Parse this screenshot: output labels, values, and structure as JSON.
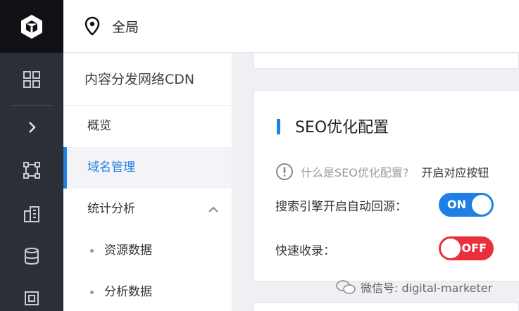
{
  "header": {
    "title": "全局"
  },
  "subnav": {
    "title": "内容分发网络CDN",
    "items": [
      {
        "label": "概览"
      },
      {
        "label": "域名管理"
      },
      {
        "label": "统计分析"
      }
    ],
    "subitems": [
      {
        "label": "资源数据"
      },
      {
        "label": "分析数据"
      }
    ]
  },
  "seo": {
    "title": "SEO优化配置",
    "help_question": "什么是SEO优化配置?",
    "help_answer": "开启对应按钮",
    "rows": [
      {
        "label": "搜索引擎开启自动回源：",
        "toggle": "ON"
      },
      {
        "label": "快速收录：",
        "toggle": "OFF"
      }
    ]
  },
  "watermark": "微信号: digital-marketer",
  "colors": {
    "accent": "#1f7fe5",
    "off": "#e9303c",
    "rail": "#2b2f38"
  }
}
